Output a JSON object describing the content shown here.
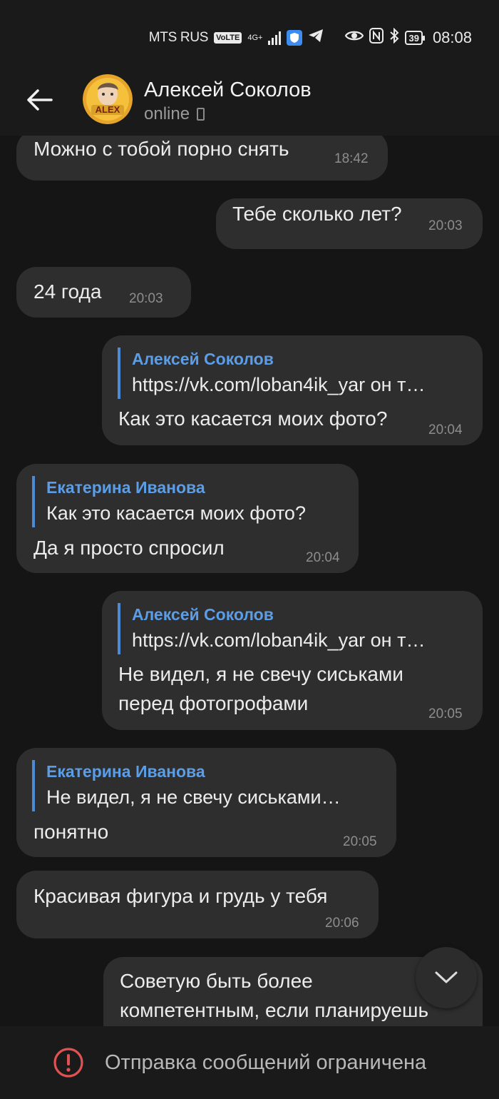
{
  "status_bar": {
    "carrier": "MTS RUS",
    "volte": "VoLTE",
    "network": "4G+",
    "battery": "39",
    "time": "08:08"
  },
  "header": {
    "contact_name": "Алексей Соколов",
    "status": "online",
    "avatar_text": "ALEX"
  },
  "messages": [
    {
      "id": "m1",
      "direction": "in",
      "text": "Можно с тобой порно снять",
      "time": "18:42"
    },
    {
      "id": "m2",
      "direction": "out",
      "text": "Тебе сколько лет?",
      "time": "20:03"
    },
    {
      "id": "m3",
      "direction": "in",
      "text": "24 года",
      "time": "20:03"
    },
    {
      "id": "m4",
      "direction": "out",
      "reply_name": "Алексей Соколов",
      "reply_text": "https://vk.com/loban4ik_yar он т…",
      "text": "Как это касается моих фото?",
      "time": "20:04"
    },
    {
      "id": "m5",
      "direction": "in",
      "reply_name": "Екатерина Иванова",
      "reply_text": "Как это касается моих фото?",
      "text": "Да я просто спросил",
      "time": "20:04"
    },
    {
      "id": "m6",
      "direction": "out",
      "reply_name": "Алексей Соколов",
      "reply_text": "https://vk.com/loban4ik_yar он т…",
      "text_line1": "Не видел, я не свечу сиськами",
      "text_line2": "перед фотогрофами",
      "time": "20:05"
    },
    {
      "id": "m7",
      "direction": "in",
      "reply_name": "Екатерина Иванова",
      "reply_text": "Не видел, я не свечу сиськами…",
      "text": "понятно",
      "time": "20:05"
    },
    {
      "id": "m8",
      "direction": "in",
      "text": "Красивая фигура и грудь у тебя",
      "time": "20:06"
    },
    {
      "id": "m9",
      "direction": "out",
      "text_line1": "Советую быть более",
      "text_line2": "компетентным, если планируешь"
    }
  ],
  "footer": {
    "restricted_text": "Отправка сообщений ограничена"
  },
  "colors": {
    "background": "#151515",
    "bubble": "#2e2e2e",
    "reply_accent": "#5b9de6",
    "alert": "#e05252"
  }
}
